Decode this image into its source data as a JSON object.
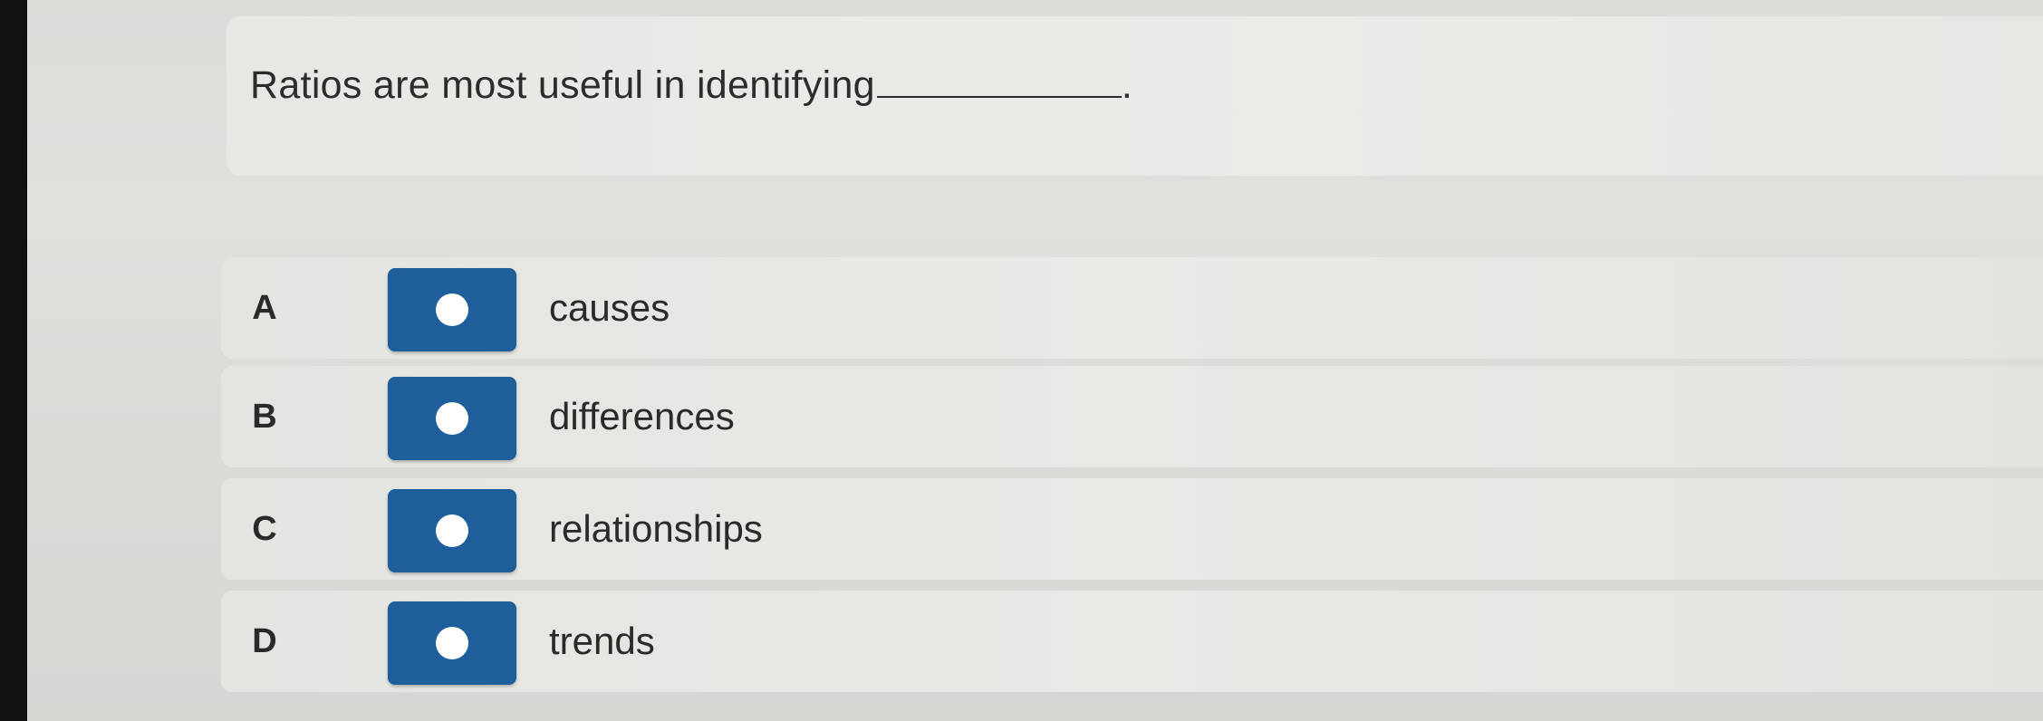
{
  "question": {
    "text": "Ratios are most useful in identifying",
    "suffix": "."
  },
  "options": [
    {
      "letter": "A",
      "label": "causes"
    },
    {
      "letter": "B",
      "label": "differences"
    },
    {
      "letter": "C",
      "label": "relationships"
    },
    {
      "letter": "D",
      "label": "trends"
    }
  ],
  "colors": {
    "radio_button": "#1e5f9b",
    "radio_dot": "#ffffff",
    "background": "#dcdcd9"
  }
}
